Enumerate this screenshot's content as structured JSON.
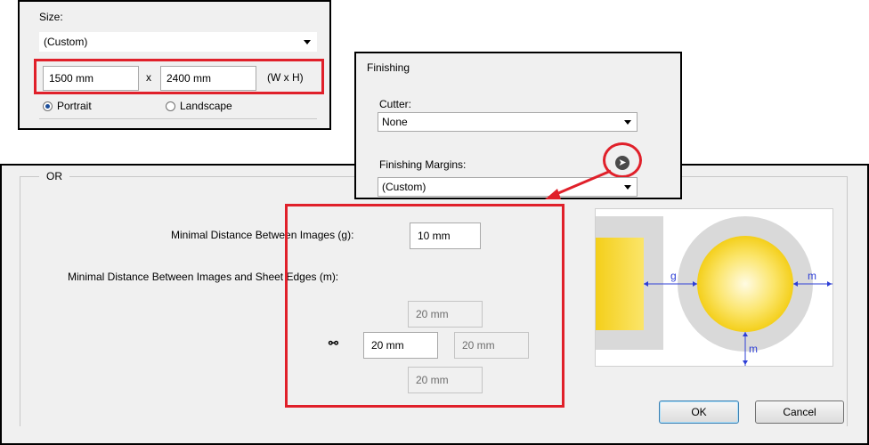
{
  "size_panel": {
    "title": "Size:",
    "size_select": "(Custom)",
    "width_value": "1500 mm",
    "separator": "x",
    "height_value": "2400 mm",
    "units_hint": "(W x H)",
    "portrait_label": "Portrait",
    "landscape_label": "Landscape",
    "orientation_selected": "Portrait"
  },
  "finishing_panel": {
    "title": "Finishing",
    "cutter_label": "Cutter:",
    "cutter_value": "None",
    "margins_label": "Finishing Margins:",
    "margins_value": "(Custom)"
  },
  "main_dialog": {
    "group_title": "OR",
    "min_distance_label": "Minimal Distance Between Images (g):",
    "min_distance_value": "10 mm",
    "edges_label": "Minimal Distance Between Images and Sheet Edges (m):",
    "margin_top": "20 mm",
    "margin_left": "20 mm",
    "margin_right": "20 mm",
    "margin_bottom": "20 mm",
    "diagram_labels": {
      "g": "g",
      "m_right": "m",
      "m_bottom": "m"
    },
    "ok_label": "OK",
    "cancel_label": "Cancel"
  },
  "colors": {
    "highlight": "#e0202a",
    "arrow_blue": "#2e3fd6",
    "image_yellow": "#f7d51c"
  }
}
